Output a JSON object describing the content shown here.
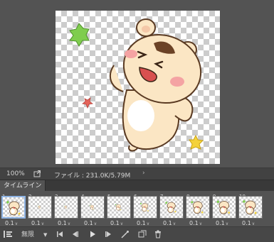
{
  "status_bar": {
    "zoom": "100%",
    "doc_info": "ファイル : 231.0K/5.79M",
    "arrow": "›"
  },
  "timeline": {
    "tab_label": "タイムライン",
    "frames": [
      {
        "num": "1",
        "delay": "0.1",
        "selected": true
      },
      {
        "num": "2",
        "delay": "0.1"
      },
      {
        "num": "3",
        "delay": "0.1"
      },
      {
        "num": "4",
        "delay": "0.1"
      },
      {
        "num": "5",
        "delay": "0.1"
      },
      {
        "num": "6",
        "delay": "0.1"
      },
      {
        "num": "7",
        "delay": "0.1"
      },
      {
        "num": "8",
        "delay": "0.1"
      },
      {
        "num": "9",
        "delay": "0.1"
      },
      {
        "num": "10",
        "delay": "0.1"
      }
    ],
    "loop_option": "無限"
  },
  "colors": {
    "hamster_body": "#fbe6c4",
    "hamster_outline": "#5a3a22",
    "cheek": "#f4a3a3",
    "mouth": "#d8504f",
    "belly": "#ffffff",
    "leaf_green": "#7fcd4e",
    "star_yellow": "#f4d23a",
    "star_red": "#e5645a",
    "selection": "#8fb4e4"
  }
}
